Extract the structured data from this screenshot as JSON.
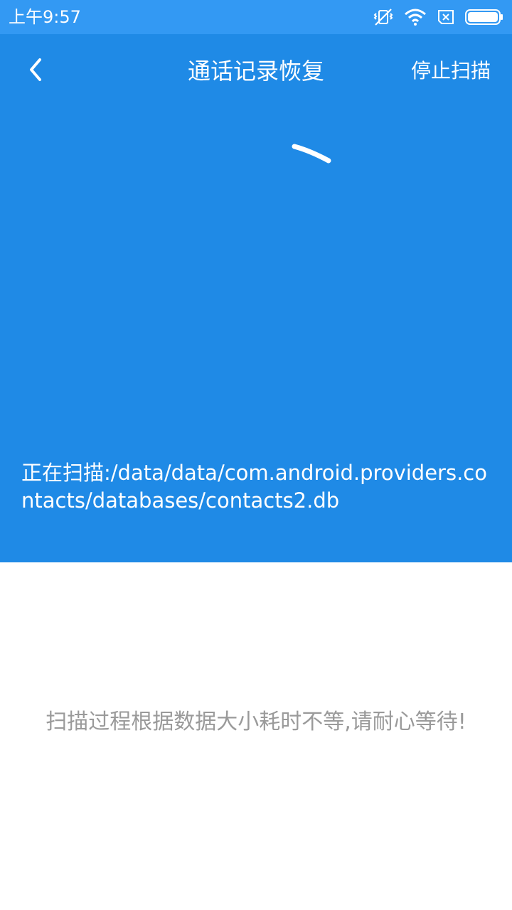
{
  "status_bar": {
    "time": "上午9:57",
    "icons": [
      "vibrate-off-icon",
      "wifi-icon",
      "no-sim-icon",
      "battery-icon"
    ]
  },
  "app_bar": {
    "back_icon": "chevron-left-icon",
    "title": "通话记录恢复",
    "stop_label": "停止扫描"
  },
  "scan": {
    "spinner_icon": "loading-spinner-icon",
    "path_text": "正在扫描:/data/data/com.android.providers.contacts/databases/contacts2.db"
  },
  "hint": {
    "text": "扫描过程根据数据大小耗时不等,请耐心等待!"
  },
  "colors": {
    "status_bar": "#3399f3",
    "primary": "#1f8ae6",
    "on_primary": "#ffffff",
    "hint_text": "#9a9a9a"
  }
}
